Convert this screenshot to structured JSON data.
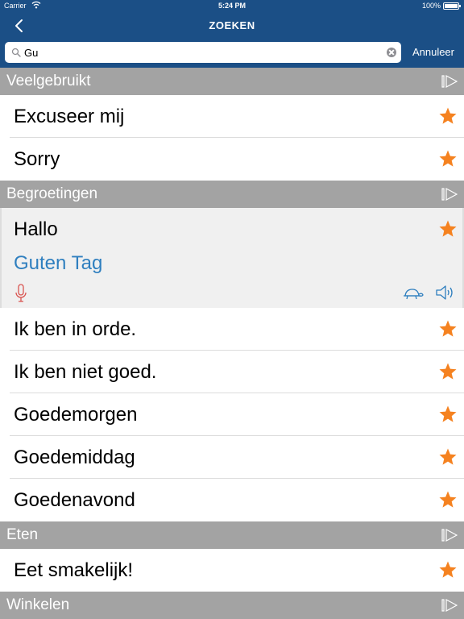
{
  "status": {
    "carrier": "Carrier",
    "time": "5:24 PM",
    "battery": "100%"
  },
  "nav": {
    "title": "ZOEKEN"
  },
  "search": {
    "value": "Gu",
    "cancel_label": "Annuleer"
  },
  "sections": [
    {
      "title": "Veelgebruikt",
      "items": [
        {
          "text": "Excuseer mij"
        },
        {
          "text": "Sorry"
        }
      ]
    },
    {
      "title": "Begroetingen",
      "items": [
        {
          "text": "Hallo",
          "translation": "Guten Tag",
          "expanded": true
        },
        {
          "text": "Ik ben in orde."
        },
        {
          "text": "Ik ben niet goed."
        },
        {
          "text": "Goedemorgen"
        },
        {
          "text": "Goedemiddag"
        },
        {
          "text": "Goedenavond"
        }
      ]
    },
    {
      "title": "Eten",
      "items": [
        {
          "text": "Eet smakelijk!"
        }
      ]
    },
    {
      "title": "Winkelen",
      "items": []
    }
  ],
  "colors": {
    "nav_bg": "#1b4f86",
    "section_bg": "#a3a3a3",
    "star": "#f58220",
    "translation": "#2f7fbf",
    "mic": "#d9534f",
    "accent_icon": "#2f7fbf"
  }
}
